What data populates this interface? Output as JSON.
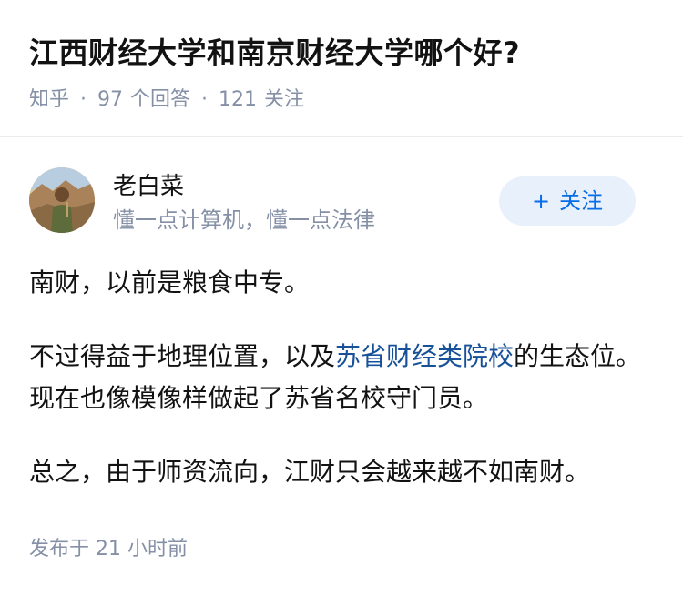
{
  "question": {
    "title": "江西财经大学和南京财经大学哪个好?",
    "meta": {
      "site": "知乎",
      "separator": "·",
      "answers_count": "97",
      "answers_label": "个回答",
      "followers_count": "121",
      "followers_label": "关注"
    }
  },
  "author": {
    "name": "老白菜",
    "bio": "懂一点计算机，懂一点法律",
    "follow_button": {
      "icon": "+",
      "label": "关注"
    }
  },
  "answer": {
    "paragraphs": [
      {
        "text": "南财，以前是粮食中专。"
      },
      {
        "before": "不过得益于地理位置，以及",
        "link": "苏省财经类院校",
        "after": "的生态位。现在也像模像样做起了苏省名校守门员。"
      },
      {
        "text": "总之，由于师资流向，江财只会越来越不如南财。"
      }
    ]
  },
  "footer": {
    "publish_label": "发布于",
    "publish_time": "21 小时前"
  },
  "colors": {
    "title": "#121212",
    "meta": "#8590a6",
    "link": "#175199",
    "follow_bg": "#e8f0fb",
    "follow_text": "#056de8"
  }
}
